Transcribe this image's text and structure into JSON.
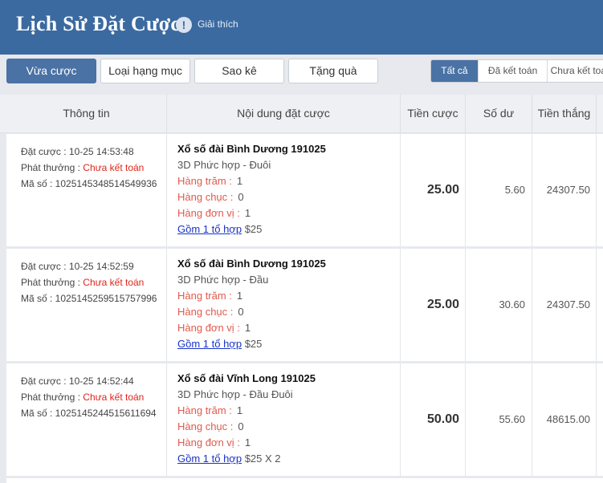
{
  "header": {
    "title": "Lịch Sử Đặt Cược",
    "help_icon": "info-circle-icon",
    "help_text": "Giải thích",
    "bg_color": "#3b6aa0"
  },
  "tabs": [
    {
      "label": "Vừa cược",
      "active": true
    },
    {
      "label": "Loại hạng mục",
      "active": false
    },
    {
      "label": "Sao kê",
      "active": false
    },
    {
      "label": "Tặng quà",
      "active": false
    }
  ],
  "filters": [
    {
      "label": "Tất cả",
      "active": true
    },
    {
      "label": "Đã kết toán",
      "active": false
    },
    {
      "label": "Chưa kết toán",
      "active": false
    }
  ],
  "table": {
    "headers": [
      "Thông tin",
      "Nội dung đặt cược",
      "Tiền cược",
      "Số dư",
      "Tiền thắng"
    ],
    "rows": [
      {
        "bet_time_label": "Đặt cược : 10-25 14:53:48",
        "payout_label": "Phát thưởng : ",
        "payout_status": "Chưa kết toán",
        "code_label": "Mã số : 1025145348514549936",
        "name": "Xổ số đài Bình Dương 191025",
        "type": "3D Phức hợp - Đuôi",
        "lines": [
          {
            "label": "Hàng trăm :",
            "value": "1"
          },
          {
            "label": "Hàng chục :",
            "value": "0"
          },
          {
            "label": "Hàng đơn vị :",
            "value": "1"
          }
        ],
        "combo_link": "Gồm 1 tổ hợp",
        "combo_amount": "$25",
        "stake": "25.00",
        "balance": "5.60",
        "win": "24307.50"
      },
      {
        "bet_time_label": "Đặt cược : 10-25 14:52:59",
        "payout_label": "Phát thưởng : ",
        "payout_status": "Chưa kết toán",
        "code_label": "Mã số : 1025145259515757996",
        "name": "Xổ số đài Bình Dương 191025",
        "type": "3D Phức hợp - Đầu",
        "lines": [
          {
            "label": "Hàng trăm :",
            "value": "1"
          },
          {
            "label": "Hàng chục :",
            "value": "0"
          },
          {
            "label": "Hàng đơn vị :",
            "value": "1"
          }
        ],
        "combo_link": "Gồm 1 tổ hợp",
        "combo_amount": "$25",
        "stake": "25.00",
        "balance": "30.60",
        "win": "24307.50"
      },
      {
        "bet_time_label": "Đặt cược : 10-25 14:52:44",
        "payout_label": "Phát thưởng : ",
        "payout_status": "Chưa kết toán",
        "code_label": "Mã số : 1025145244515611694",
        "name": "Xổ số đài Vĩnh Long 191025",
        "type": "3D Phức hợp - Đầu Đuôi",
        "lines": [
          {
            "label": "Hàng trăm :",
            "value": "1"
          },
          {
            "label": "Hàng chục :",
            "value": "0"
          },
          {
            "label": "Hàng đơn vị :",
            "value": "1"
          }
        ],
        "combo_link": "Gồm 1 tổ hợp",
        "combo_amount": "$25 X 2",
        "stake": "50.00",
        "balance": "55.60",
        "win": "48615.00"
      }
    ]
  }
}
